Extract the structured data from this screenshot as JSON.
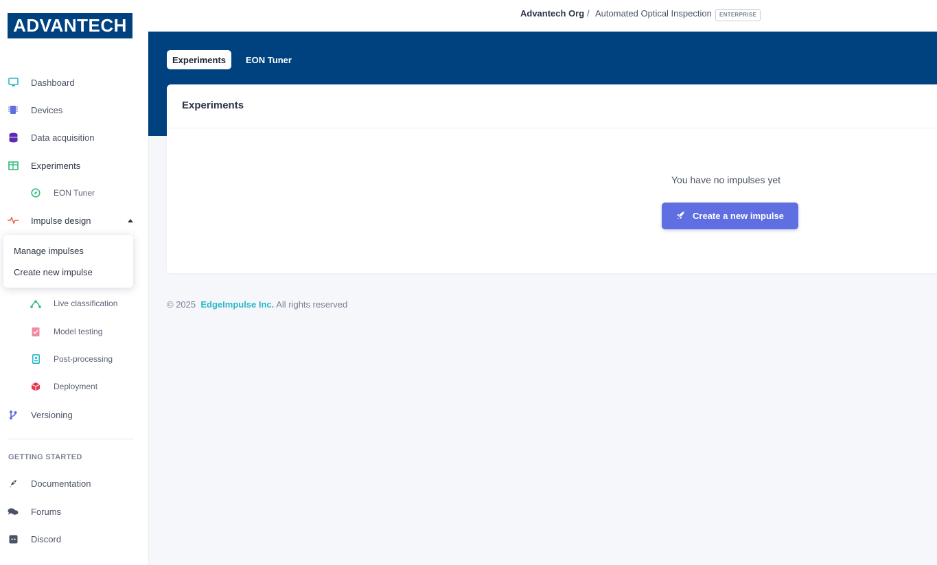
{
  "logo": {
    "text": "ADVANTECH"
  },
  "breadcrumb": {
    "org": "Advantech Org",
    "separator": "/",
    "project": "Automated Optical Inspection",
    "badge": "ENTERPRISE"
  },
  "sidebar": {
    "items": [
      {
        "label": "Dashboard",
        "icon": "monitor-icon"
      },
      {
        "label": "Devices",
        "icon": "chip-icon"
      },
      {
        "label": "Data acquisition",
        "icon": "database-icon"
      },
      {
        "label": "Experiments",
        "icon": "table-icon"
      },
      {
        "label": "EON Tuner",
        "icon": "compass-icon"
      },
      {
        "label": "Impulse design",
        "icon": "pulse-icon"
      },
      {
        "label": "Live classification",
        "icon": "network-icon"
      },
      {
        "label": "Model testing",
        "icon": "clipboard-check-icon"
      },
      {
        "label": "Post-processing",
        "icon": "id-badge-icon"
      },
      {
        "label": "Deployment",
        "icon": "cube-icon"
      },
      {
        "label": "Versioning",
        "icon": "branch-icon"
      }
    ],
    "section_title": "GETTING STARTED",
    "getting_started": [
      {
        "label": "Documentation",
        "icon": "rocket-doc-icon"
      },
      {
        "label": "Forums",
        "icon": "chat-icon"
      },
      {
        "label": "Discord",
        "icon": "discord-icon"
      }
    ]
  },
  "popover": {
    "items": [
      "Manage impulses",
      "Create new impulse"
    ]
  },
  "tabs": [
    {
      "label": "Experiments"
    },
    {
      "label": "EON Tuner"
    }
  ],
  "card": {
    "title": "Experiments",
    "empty_text": "You have no impulses yet",
    "button_label": "Create a new impulse"
  },
  "footer": {
    "copyright": "© 2025",
    "brand": "EdgeImpulse Inc.",
    "rights": "All rights reserved"
  },
  "colors": {
    "primary_blue": "#004280",
    "button": "#5f6ee0",
    "brand_teal": "#2cb7c9"
  }
}
